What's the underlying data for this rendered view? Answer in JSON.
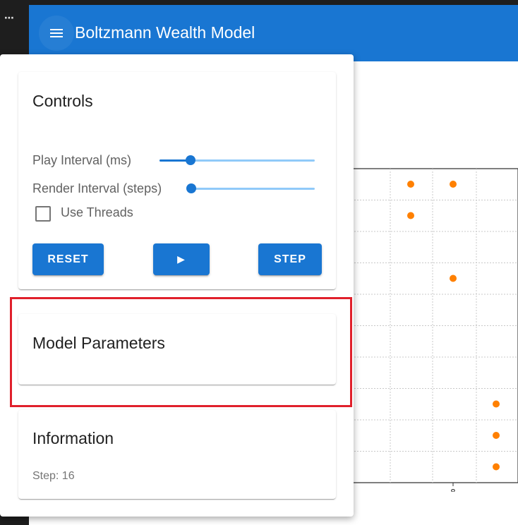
{
  "window": {
    "more_icon": "⋯"
  },
  "appbar": {
    "title": "Boltzmann Wealth Model",
    "menu_icon": "hamburger-menu-icon",
    "color": "#1976d2"
  },
  "controls": {
    "title": "Controls",
    "play_interval": {
      "label": "Play Interval (ms)",
      "value_fraction": 0.2
    },
    "render_interval": {
      "label": "Render Interval (steps)",
      "value_fraction": 0.0
    },
    "use_threads": {
      "label": "Use Threads",
      "checked": false
    },
    "buttons": {
      "reset": "RESET",
      "play": "▶",
      "step": "STEP"
    }
  },
  "model_parameters": {
    "title": "Model Parameters"
  },
  "information": {
    "title": "Information",
    "step_text": "Step: 16"
  },
  "chart_data": {
    "type": "scatter",
    "x_tick_labels": [
      "8"
    ],
    "grid": true,
    "point_color": "#ff8000",
    "points": [
      {
        "col": 7,
        "row": 0
      },
      {
        "col": 8,
        "row": 0
      },
      {
        "col": 7,
        "row": 1
      },
      {
        "col": 8,
        "row": 3
      },
      {
        "col": 9,
        "row": 7
      },
      {
        "col": 9,
        "row": 8
      },
      {
        "col": 9,
        "row": 9
      }
    ]
  }
}
